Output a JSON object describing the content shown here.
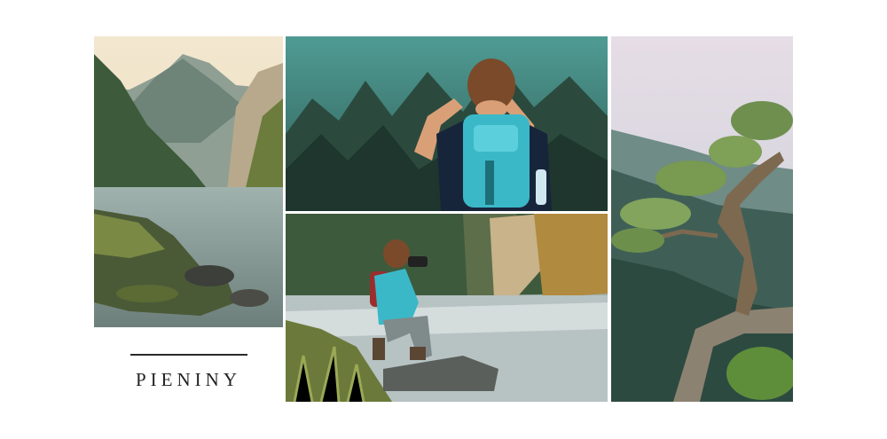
{
  "title": "PIENINY",
  "photos": {
    "river": "mountain-river-gorge-photo",
    "hiker_back": "hiker-with-backpack-photo",
    "hiker_binoculars": "hiker-with-binoculars-on-rock-photo",
    "pine": "sokolica-pine-tree-photo"
  },
  "colors": {
    "background": "#ffffff",
    "title_text": "#222222",
    "accent_teal": "#3bb8c8"
  }
}
